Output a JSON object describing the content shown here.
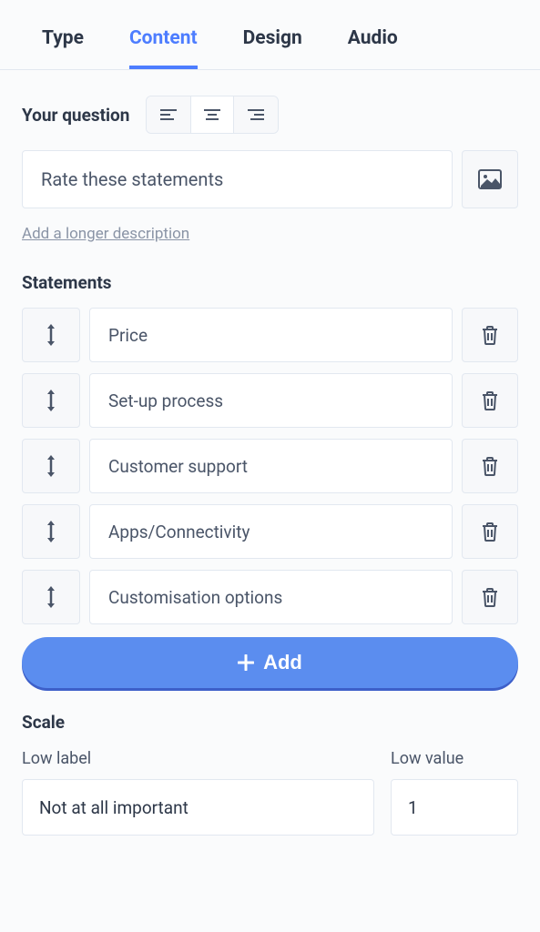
{
  "tabs": {
    "type": "Type",
    "content": "Content",
    "design": "Design",
    "audio": "Audio",
    "active": "content"
  },
  "question": {
    "label": "Your question",
    "value": "Rate these statements",
    "desc_link": "Add a longer description"
  },
  "statements": {
    "label": "Statements",
    "items": [
      {
        "text": "Price"
      },
      {
        "text": "Set-up process"
      },
      {
        "text": "Customer support"
      },
      {
        "text": "Apps/Connectivity"
      },
      {
        "text": "Customisation options"
      }
    ],
    "add_label": "Add"
  },
  "scale": {
    "label": "Scale",
    "low_label_caption": "Low label",
    "low_label_value": "Not at all important",
    "low_value_caption": "Low value",
    "low_value_value": "1"
  }
}
